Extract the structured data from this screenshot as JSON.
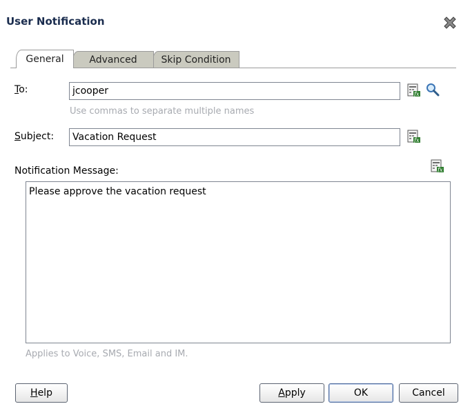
{
  "dialog": {
    "title": "User Notification"
  },
  "tabs": [
    {
      "label": "General",
      "active": true
    },
    {
      "label": "Advanced",
      "active": false
    },
    {
      "label": "Skip Condition",
      "active": false
    }
  ],
  "general": {
    "to": {
      "mnemonic": "T",
      "rest": "o:",
      "value": "jcooper",
      "hint": "Use commas to separate multiple names"
    },
    "subject": {
      "mnemonic": "S",
      "rest": "ubject:",
      "value": "Vacation Request"
    },
    "message": {
      "label": "Notification Message:",
      "value": "Please approve the vacation request"
    },
    "footer_note": "Applies to Voice, SMS, Email and IM."
  },
  "buttons": {
    "help": {
      "mnemonic": "H",
      "rest": "elp"
    },
    "apply": {
      "mnemonic": "A",
      "rest": "pply"
    },
    "ok": {
      "label": "OK"
    },
    "cancel": {
      "label": "Cancel"
    }
  },
  "icons": {
    "close": "close-icon",
    "expression_builder": "expression-builder-icon",
    "search": "search-icon"
  },
  "colors": {
    "title": "#1a2c4e",
    "tab_inactive": "#cacabf",
    "hint": "#a7aab0",
    "default_button_border": "#4c6a9c"
  }
}
